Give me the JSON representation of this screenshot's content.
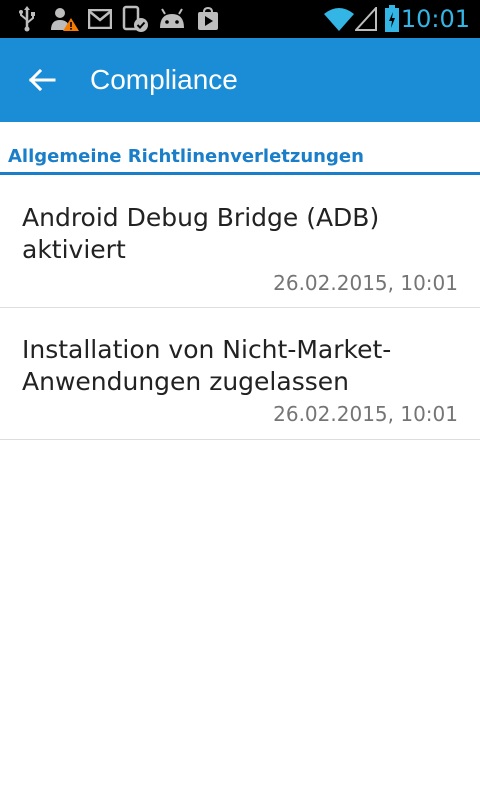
{
  "status_bar": {
    "time": "10:01",
    "icons": [
      "usb-icon",
      "user-warning-icon",
      "gmail-icon",
      "device-check-icon",
      "android-icon",
      "play-store-icon",
      "wifi-icon",
      "signal-icon",
      "battery-charging-icon"
    ]
  },
  "app_bar": {
    "back_icon": "arrow-back-icon",
    "title": "Compliance"
  },
  "section": {
    "label": "Allgemeine Richtlinenverletzungen"
  },
  "items": [
    {
      "title": "Android Debug Bridge (ADB) aktiviert",
      "timestamp": "26.02.2015, 10:01"
    },
    {
      "title": "Installation von Nicht-Market-Anwendungen zugelassen",
      "timestamp": "26.02.2015, 10:01"
    }
  ],
  "colors": {
    "app_bar": "#1a8dd6",
    "accent": "#1a7ec8",
    "status_time": "#33b5e5"
  }
}
